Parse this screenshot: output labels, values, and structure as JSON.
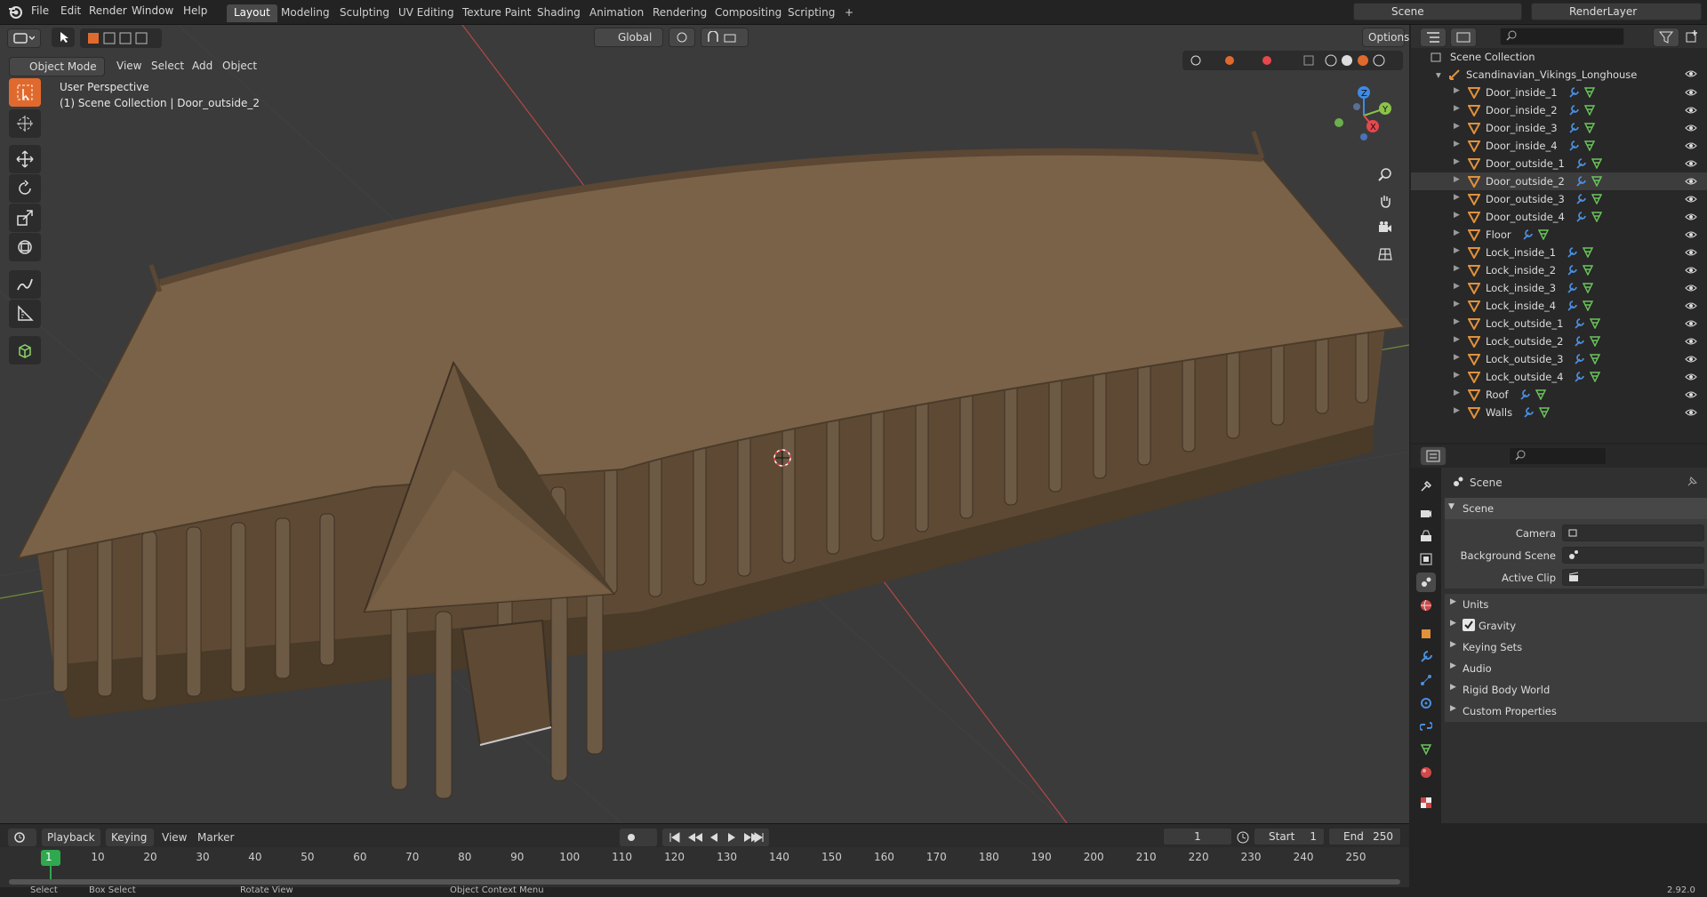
{
  "topbar": {
    "menus": [
      "File",
      "Edit",
      "Render",
      "Window",
      "Help"
    ],
    "workspaces": [
      "Layout",
      "Modeling",
      "Sculpting",
      "UV Editing",
      "Texture Paint",
      "Shading",
      "Animation",
      "Rendering",
      "Compositing",
      "Scripting"
    ],
    "active_workspace": "Layout",
    "add_tab": "+",
    "scene_name": "Scene",
    "render_layer": "RenderLayer"
  },
  "viewport": {
    "mode": "Object Mode",
    "menus": [
      "View",
      "Select",
      "Add",
      "Object"
    ],
    "orientation": "Global",
    "options": "Options",
    "perspective": "User Perspective",
    "collection_info": "(1) Scene Collection | Door_outside_2"
  },
  "outliner": {
    "root": "Scene Collection",
    "collection": "Scandinavian_Vikings_Longhouse",
    "selected": "Door_outside_2",
    "objects": [
      "Door_inside_1",
      "Door_inside_2",
      "Door_inside_3",
      "Door_inside_4",
      "Door_outside_1",
      "Door_outside_2",
      "Door_outside_3",
      "Door_outside_4",
      "Floor",
      "Lock_inside_1",
      "Lock_inside_2",
      "Lock_inside_3",
      "Lock_inside_4",
      "Lock_outside_1",
      "Lock_outside_2",
      "Lock_outside_3",
      "Lock_outside_4",
      "Roof",
      "Walls"
    ]
  },
  "properties": {
    "context": "Scene",
    "panel_title": "Scene",
    "camera_label": "Camera",
    "background_scene_label": "Background Scene",
    "active_clip_label": "Active Clip",
    "units": "Units",
    "gravity": "Gravity",
    "gravity_checked": true,
    "keying_sets": "Keying Sets",
    "audio": "Audio",
    "rigid_body_world": "Rigid Body World",
    "custom_properties": "Custom Properties"
  },
  "timeline": {
    "playback": "Playback",
    "keying": "Keying",
    "view": "View",
    "marker": "Marker",
    "current_frame": "1",
    "start_label": "Start",
    "start": "1",
    "end_label": "End",
    "end": "250",
    "ticks": [
      "1",
      "10",
      "20",
      "30",
      "40",
      "50",
      "60",
      "70",
      "80",
      "90",
      "100",
      "110",
      "120",
      "130",
      "140",
      "150",
      "160",
      "170",
      "180",
      "190",
      "200",
      "210",
      "220",
      "230",
      "240",
      "250"
    ]
  },
  "statusbar": {
    "select": "Select",
    "box_select": "Box Select",
    "rotate_view": "Rotate View",
    "context_menu": "Object Context Menu",
    "version": "2.92.0"
  },
  "colors": {
    "accent": "#e06a2e",
    "selection": "#4772b3",
    "axis_x": "#e5484d",
    "axis_y": "#8bc34a",
    "axis_z": "#3f8be6",
    "frame_marker": "#2fa84f"
  }
}
